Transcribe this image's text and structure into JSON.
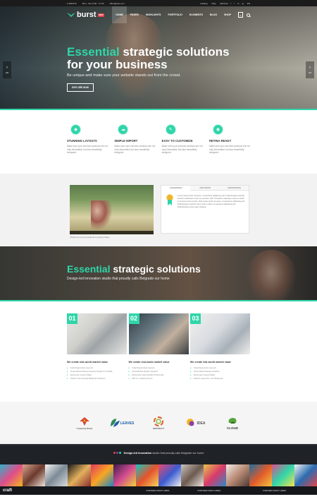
{
  "topbar": {
    "phone": "1-900-872",
    "hours": "Mon - Sat, 8:00 - 17:00",
    "email": "office@site.com",
    "links": [
      "Catalog",
      "FAQ",
      "Editorial"
    ],
    "social": [
      "f",
      "t",
      "in",
      "g+"
    ],
    "lang": "EN"
  },
  "nav": {
    "logo": "burst",
    "logo_badge": "NEW",
    "items": [
      "HOME",
      "PAGES",
      "HIGHLIGHTS",
      "PORTFOLIO",
      "ELEMENTS",
      "BLOG",
      "SHOP"
    ],
    "cart_count": "0"
  },
  "hero": {
    "accent": "Essential",
    "title_rest": " strategic solutions",
    "title_line2": "for your business",
    "subtitle": "Be unique and make sure your website stands out from the crowd.",
    "button": "EXPLORE NOW",
    "left_counter": "2/2",
    "right_counter": "2/2"
  },
  "features": [
    {
      "icon": "diamond-icon",
      "title": "STUNNING LAYOUTS",
      "desc": "Make sure your services sections are not only informative but also beautifully designed."
    },
    {
      "icon": "cloud-icon",
      "title": "SIMPLE IMPORT",
      "desc": "Make sure your services sections are not only informative but also beautifully designed."
    },
    {
      "icon": "pencil-icon",
      "title": "EASY TO CUSTOMIZE",
      "desc": "Make sure your services sections are not only informative but also beautifully designed."
    },
    {
      "icon": "eye-icon",
      "title": "RETINA READY",
      "desc": "Make sure your services sections are not only informative but also beautifully designed."
    }
  ],
  "video": {
    "caption": "Check out our promotional company video",
    "tabs": [
      "OUR MISSION",
      "OUR VISION",
      "OUR POSITION"
    ],
    "tab_text": "Lorem ipsum dolor sit amet, consectetur adipiscing elit. Pellentesque pulvinar lobortis vestibulum tortor eu posuere odio. Praesent vulputate a elit eu mollis. In sit amet purus luctus. Duis ipsum dolor sit amet, consectetur adipiscing elit. Pellentesque pulvinar lorem ipsum dolor consectetur adipiscing elit. Pellentesque purus eget volutpat."
  },
  "hero2": {
    "accent": "Essential",
    "title_rest": " strategic solutions",
    "subtitle": "Design-led innovation studio that proudly calls Belgrade our home"
  },
  "cards": [
    {
      "num": "01",
      "title": "We create real-world market value",
      "items": [
        "Fully Responsive Layouts",
        "Great Retina Ready Graphics Ready For Mobile",
        "Extremely Customizable",
        "Perfect User-friendly Backend Solutions"
      ]
    },
    {
      "num": "02",
      "title": "We create real-world market value",
      "items": [
        "Fully Responsive Layouts",
        "Great Retina Ready Graphics",
        "Extremely Customizable Shortcodes",
        "WP 4.1+ Ready Theme"
      ]
    },
    {
      "num": "03",
      "title": "We create real-world market value",
      "items": [
        "Fully Responsive Layouts",
        "Great Retina Ready Graphics",
        "Extremely Customizable",
        "Perfect Layout For Your Business"
      ]
    }
  ],
  "clients": [
    {
      "name": "Company Name",
      "icon": "eagle-logo"
    },
    {
      "name": "LEAVES",
      "icon": "leaves-logo"
    },
    {
      "name": "ABSTRACT",
      "icon": "abstract-logo"
    },
    {
      "name": "IDEA",
      "icon": "idea-logo"
    },
    {
      "name": "CLOUD",
      "icon": "cloud-logo"
    }
  ],
  "footer": {
    "tag_bold": "Design-led innovation",
    "tag_rest": " studio that proudly calls Belgrade our home",
    "brand": "craft",
    "cols": [
      "FURTHER CRAFT LINKS",
      "FURTHER CRAFT LINKS",
      "FURTHER CRAFT LINKS"
    ]
  },
  "colors": {
    "accent": "#2fd6a9",
    "dark": "#1f2227"
  }
}
